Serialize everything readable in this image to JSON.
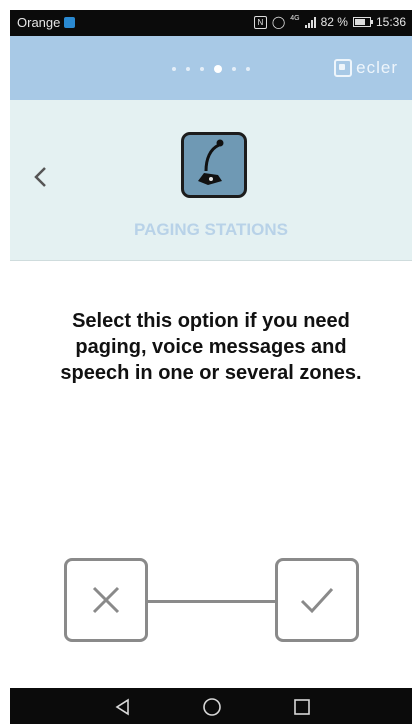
{
  "status_bar": {
    "carrier": "Orange",
    "battery_text": "82 %",
    "time": "15:36",
    "network": "4G"
  },
  "app_bar": {
    "brand": "ecler",
    "page_count": 7,
    "active_page": 4
  },
  "header": {
    "back_icon": "chevron-left-icon",
    "option_icon": "paging-microphone-icon",
    "title": "PAGING STATIONS"
  },
  "main": {
    "message": "Select this option if you need paging, voice messages and speech in one or several zones."
  },
  "actions": {
    "cancel_icon": "close-icon",
    "confirm_icon": "check-icon"
  },
  "nav_bar": {
    "back_icon": "triangle-back-icon",
    "home_icon": "circle-home-icon",
    "recents_icon": "square-recents-icon"
  },
  "colors": {
    "app_bar": "#a8c9e6",
    "header_bg": "#e4f1f2",
    "title": "#b8d2e8",
    "choice_border": "#8a8a8a"
  }
}
